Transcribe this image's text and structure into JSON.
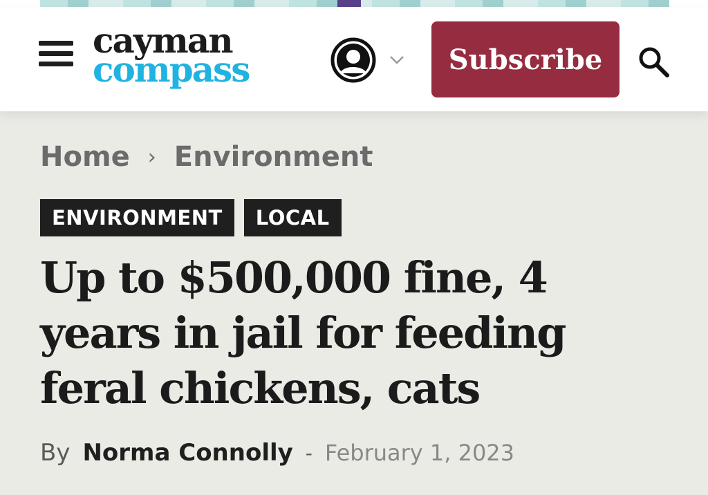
{
  "header": {
    "logo_line1": "cayman",
    "logo_line2": "compass",
    "subscribe_label": "Subscribe",
    "icons": {
      "menu": "hamburger-menu-icon",
      "account": "user-account-icon",
      "account_dropdown": "chevron-down-icon",
      "search": "search-icon"
    },
    "colors": {
      "logo_dark": "#1c1c1c",
      "logo_accent": "#1eb3e0",
      "subscribe_bg": "#962c3f"
    }
  },
  "breadcrumb": {
    "items": [
      "Home",
      "Environment"
    ],
    "separator": "›"
  },
  "tags": [
    "ENVIRONMENT",
    "LOCAL"
  ],
  "article": {
    "headline": "Up to $500,000 fine, 4 years in jail for feeding feral chickens, cats",
    "by_label": "By",
    "author": "Norma Connolly",
    "separator": "-",
    "date": "February 1, 2023"
  },
  "colors": {
    "page_bg": "#ebebe6",
    "tag_bg": "#1f1f1f",
    "text_dark": "#1b1b1b"
  }
}
